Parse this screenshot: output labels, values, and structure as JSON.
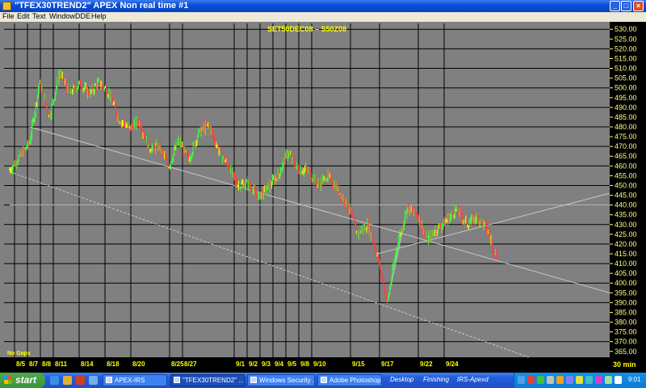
{
  "window": {
    "title": "\"TFEX30TREND2\" APEX Non real time #1",
    "controls": [
      "_",
      "□",
      "×"
    ]
  },
  "menu": [
    "File",
    "Edit",
    "Text",
    "Window",
    "DDE",
    "Help"
  ],
  "chart_data": {
    "type": "candlestick",
    "title": "SET50DEC08  –  S50Z08",
    "interval_label": "30  min",
    "corner_note": "No Gaps",
    "y_ticks": [
      "530.00",
      "525.00",
      "520.00",
      "515.00",
      "510.00",
      "505.00",
      "500.00",
      "495.00",
      "490.00",
      "485.00",
      "480.00",
      "475.00",
      "470.00",
      "465.00",
      "460.00",
      "455.00",
      "450.00",
      "445.00",
      "440.00",
      "435.00",
      "430.00",
      "425.00",
      "420.00",
      "415.00",
      "410.00",
      "405.00",
      "400.00",
      "395.00",
      "390.00",
      "385.00",
      "380.00",
      "375.00",
      "370.00",
      "365.00"
    ],
    "ylim": [
      362,
      533
    ],
    "date_labels": [
      "8/5",
      "8/7",
      "8/8",
      "8/11",
      "8/14",
      "8/18",
      "8/20",
      "8/25",
      "8/27",
      "9/1",
      "9/2",
      "9/3",
      "9/4",
      "9/5",
      "9/8",
      "9/10",
      "9/15",
      "9/17",
      "9/22",
      "9/24"
    ],
    "price_path": [
      {
        "d": 0,
        "p": 458
      },
      {
        "d": 2,
        "p": 472
      },
      {
        "d": 3,
        "p": 503
      },
      {
        "d": 4,
        "p": 485
      },
      {
        "d": 5,
        "p": 508
      },
      {
        "d": 6,
        "p": 497
      },
      {
        "d": 7,
        "p": 502
      },
      {
        "d": 8,
        "p": 497
      },
      {
        "d": 9,
        "p": 503
      },
      {
        "d": 10,
        "p": 497
      },
      {
        "d": 11,
        "p": 484
      },
      {
        "d": 12,
        "p": 479
      },
      {
        "d": 13,
        "p": 483
      },
      {
        "d": 14,
        "p": 469
      },
      {
        "d": 15,
        "p": 470
      },
      {
        "d": 16,
        "p": 460
      },
      {
        "d": 17,
        "p": 473
      },
      {
        "d": 18,
        "p": 463
      },
      {
        "d": 19,
        "p": 477
      },
      {
        "d": 20,
        "p": 481
      },
      {
        "d": 21,
        "p": 468
      },
      {
        "d": 22,
        "p": 460
      },
      {
        "d": 23,
        "p": 450
      },
      {
        "d": 24,
        "p": 451
      },
      {
        "d": 25,
        "p": 444
      },
      {
        "d": 26,
        "p": 449
      },
      {
        "d": 27,
        "p": 455
      },
      {
        "d": 28,
        "p": 467
      },
      {
        "d": 29,
        "p": 458
      },
      {
        "d": 30,
        "p": 458
      },
      {
        "d": 31,
        "p": 450
      },
      {
        "d": 32,
        "p": 455
      },
      {
        "d": 33,
        "p": 448
      },
      {
        "d": 34,
        "p": 440
      },
      {
        "d": 35,
        "p": 425
      },
      {
        "d": 36,
        "p": 430
      },
      {
        "d": 37,
        "p": 414
      },
      {
        "d": 38,
        "p": 390
      },
      {
        "d": 39,
        "p": 420
      },
      {
        "d": 40,
        "p": 438
      },
      {
        "d": 41,
        "p": 435
      },
      {
        "d": 42,
        "p": 422
      },
      {
        "d": 43,
        "p": 428
      },
      {
        "d": 44,
        "p": 432
      },
      {
        "d": 45,
        "p": 438
      },
      {
        "d": 46,
        "p": 430
      },
      {
        "d": 47,
        "p": 434
      },
      {
        "d": 48,
        "p": 428
      },
      {
        "d": 49,
        "p": 413
      }
    ],
    "horizontal_line": 440,
    "colors": {
      "background": "#808080",
      "grid": "#000000",
      "axis_panel": "#000000",
      "axis_text": "#ffff80",
      "title": "#ffff00",
      "date_text": "#ffff00",
      "up_bar": "#40ff40",
      "down_bar": "#ff4040",
      "neutral_bar": "#ffff00",
      "trendline": "#c8c8c8"
    }
  },
  "taskbar": {
    "start_label": "start",
    "tasks": [
      {
        "label": "APEX-IRS",
        "active": false
      },
      {
        "label": "\"TFEX30TREND2\" ...",
        "active": true
      },
      {
        "label": "Windows Security ...",
        "active": false
      },
      {
        "label": "Adobe Photoshop",
        "active": false
      }
    ],
    "toolbars": [
      "Desktop",
      "Finishing",
      "IRS-Apexd"
    ],
    "clock": "9:01"
  }
}
